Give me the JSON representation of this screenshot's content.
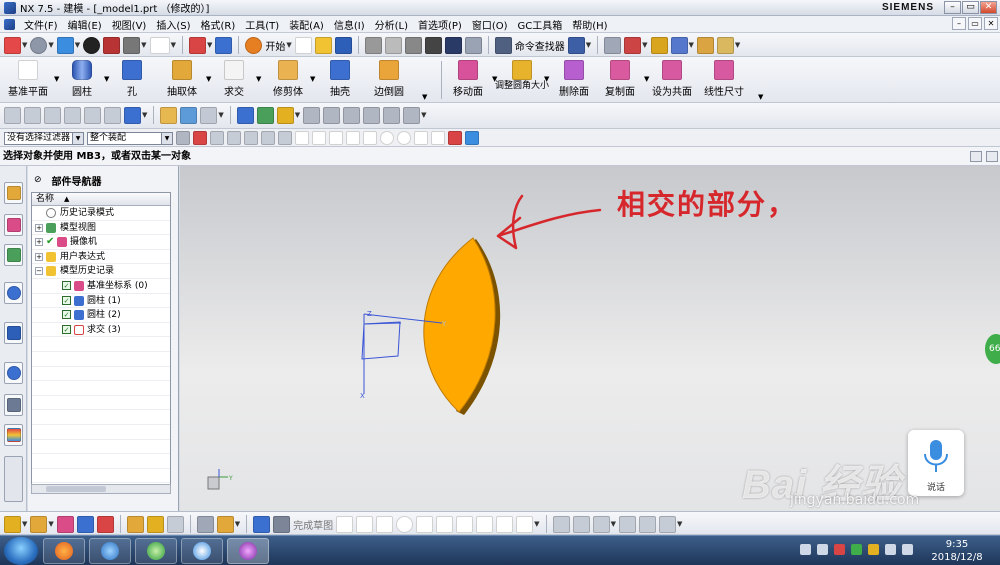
{
  "window": {
    "title": "NX 7.5 - 建模 - [_model1.prt （修改的）]",
    "brand": "SIEMENS",
    "minimize": "–",
    "maximize": "▭",
    "close": "✕"
  },
  "menubar": {
    "items": [
      "文件(F)",
      "编辑(E)",
      "视图(V)",
      "插入(S)",
      "格式(R)",
      "工具(T)",
      "装配(A)",
      "信息(I)",
      "分析(L)",
      "首选项(P)",
      "窗口(O)",
      "GC工具箱",
      "帮助(H)"
    ]
  },
  "toolbar1": {
    "start_label": "开始",
    "command_finder_label": "命令查找器"
  },
  "toolbar2": {
    "buttons": [
      "基准平面",
      "圆柱",
      "孔",
      "抽取体",
      "求交",
      "修剪体",
      "抽壳",
      "边倒圆",
      "移动面",
      "调整圆角大小",
      "删除面",
      "复制面",
      "设为共面",
      "线性尺寸"
    ]
  },
  "filter_bar": {
    "selection_filter": "没有选择过滤器",
    "assembly_scope": "整个装配"
  },
  "status_bar": {
    "prompt": "选择对象并使用 MB3，或者双击某一对象"
  },
  "navigator": {
    "title": "部件导航器",
    "column_name": "名称",
    "tree": [
      {
        "label": "历史记录模式",
        "level": 0,
        "expander": "",
        "check": false
      },
      {
        "label": "模型视图",
        "level": 0,
        "expander": "+",
        "check": false
      },
      {
        "label": "摄像机",
        "level": 0,
        "expander": "+",
        "check": true
      },
      {
        "label": "用户表达式",
        "level": 0,
        "expander": "+",
        "check": false
      },
      {
        "label": "模型历史记录",
        "level": 0,
        "expander": "−",
        "check": false
      },
      {
        "label": "基准坐标系 (0)",
        "level": 1,
        "expander": "",
        "check": true
      },
      {
        "label": "圆柱 (1)",
        "level": 1,
        "expander": "",
        "check": true
      },
      {
        "label": "圆柱 (2)",
        "level": 1,
        "expander": "",
        "check": true
      },
      {
        "label": "求交 (3)",
        "level": 1,
        "expander": "",
        "check": true
      }
    ]
  },
  "viewport": {
    "annotation": "相交的部分，",
    "shape_color": "#ffa800",
    "shape_edge_color": "#7a5200",
    "axis_color": "#3a55d6",
    "axis_labels": {
      "z": "Z",
      "x": "X",
      "y": "Y"
    }
  },
  "bottom_toolbar": {
    "sketch_label": "完成草图"
  },
  "voice_widget": {
    "label": "说话"
  },
  "side_badge": "66",
  "watermark": {
    "brand": "Bai 经验",
    "url": "jingyan.baidu.com"
  },
  "taskbar": {
    "time": "9:35",
    "date": "2018/12/8"
  }
}
